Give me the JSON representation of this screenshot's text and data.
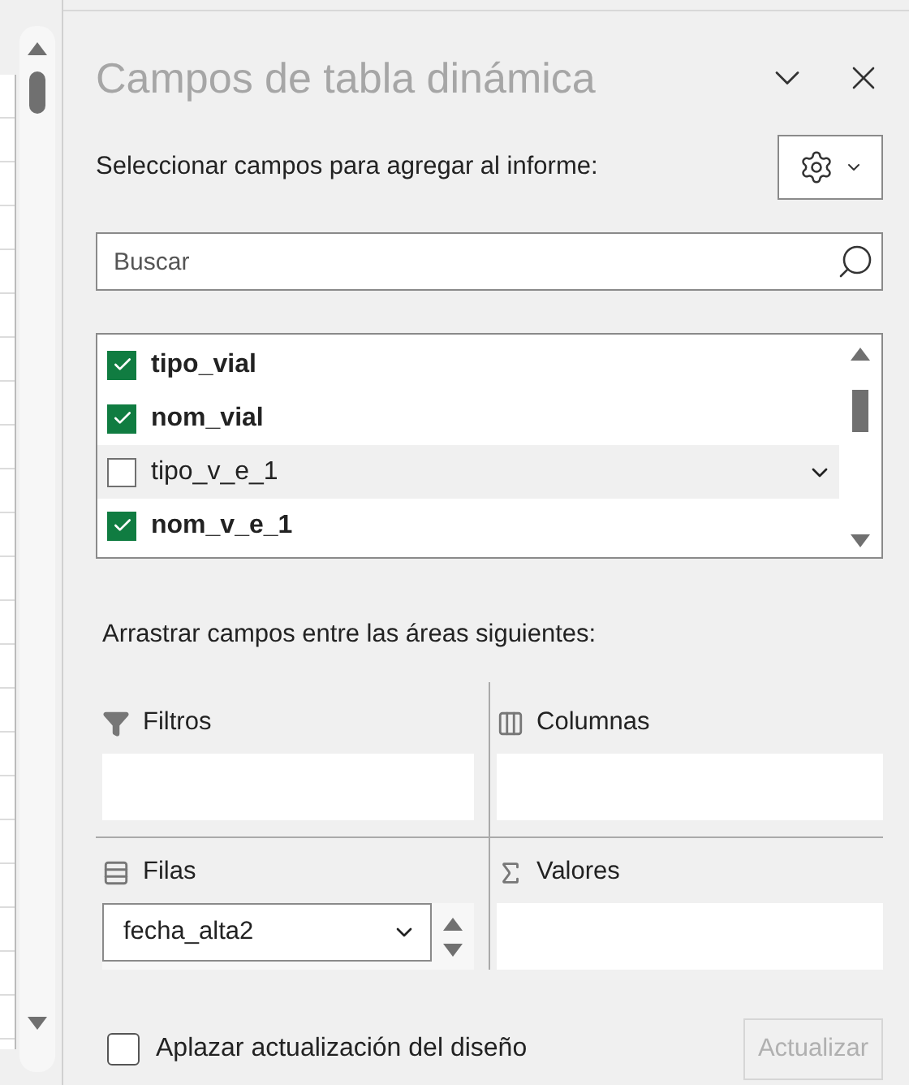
{
  "panel": {
    "title": "Campos de tabla dinámica",
    "instruction": "Seleccionar campos para agregar al informe:",
    "search": {
      "placeholder": "Buscar"
    },
    "fields": [
      {
        "label": "tipo_vial",
        "checked": true,
        "hovered": false
      },
      {
        "label": "nom_vial",
        "checked": true,
        "hovered": false
      },
      {
        "label": "tipo_v_e_1",
        "checked": false,
        "hovered": true
      },
      {
        "label": "nom_v_e_1",
        "checked": true,
        "hovered": false
      }
    ],
    "areas_instruction": "Arrastrar campos entre las áreas siguientes:",
    "areas": [
      {
        "kind": "filters",
        "label": "Filtros"
      },
      {
        "kind": "columns",
        "label": "Columnas"
      },
      {
        "kind": "rows",
        "label": "Filas",
        "items": [
          "fecha_alta2"
        ]
      },
      {
        "kind": "values",
        "label": "Valores"
      }
    ],
    "defer_update": {
      "label": "Aplazar actualización del diseño",
      "checked": false
    },
    "update_button": {
      "label": "Actualizar",
      "disabled": true
    }
  }
}
